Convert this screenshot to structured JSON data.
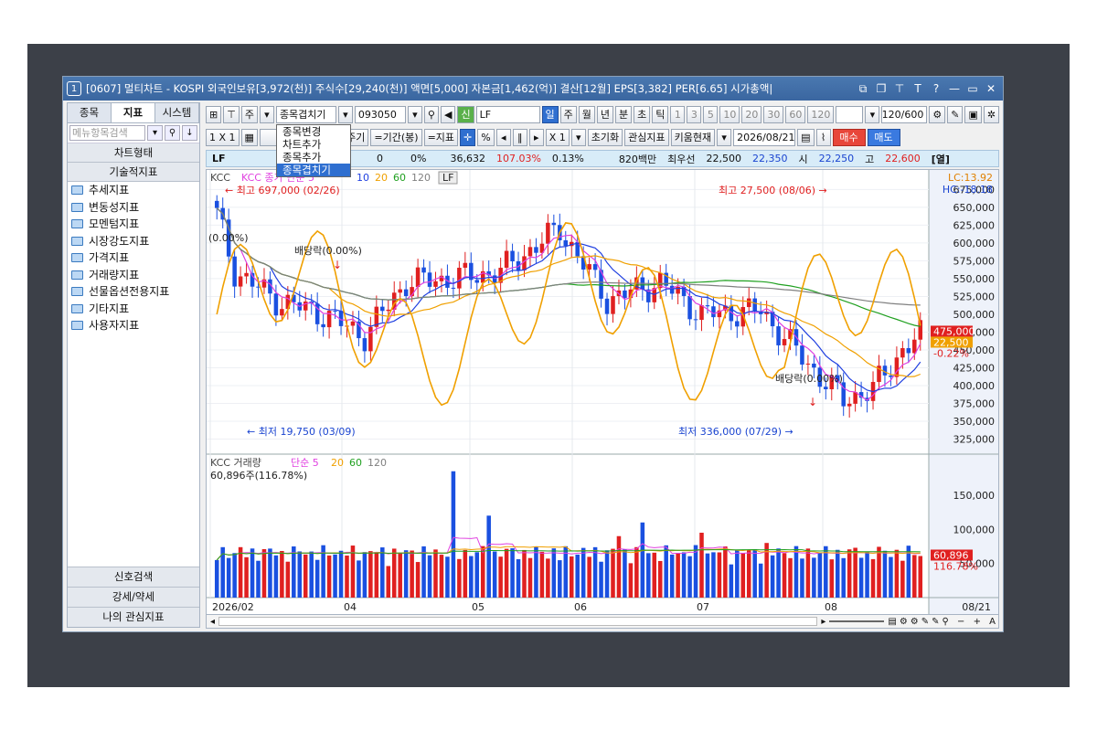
{
  "window": {
    "title_num": "1",
    "title": "[0607] 멀티차트 - KOSPI 외국인보유[3,972(천)] 주식수[29,240(천)] 액면[5,000] 자본금[1,462(억)] 결산[12월] EPS[3,382] PER[6.65] 시가총액|",
    "icons": [
      "⧉",
      "❐",
      "⊤",
      "T",
      "?",
      "—",
      "▭",
      "✕"
    ]
  },
  "left_panel": {
    "tabs": [
      "종목",
      "지표",
      "시스템"
    ],
    "active_tab": "지표",
    "search_placeholder": "메뉴항목검색",
    "section1": "차트형태",
    "section2": "기술적지표",
    "items": [
      "추세지표",
      "변동성지표",
      "모멘텀지표",
      "시장강도지표",
      "가격지표",
      "거래량지표",
      "선물옵션전용지표",
      "기타지표",
      "사용자지표"
    ],
    "bottom": [
      "신호검색",
      "강세/약세",
      "나의 관심지표"
    ]
  },
  "toolbar1": {
    "mode_label": "주",
    "combo_label": "종목겹치기",
    "code": "093050",
    "name": "LF",
    "new_badge": "신",
    "periods": [
      "일",
      "주",
      "월",
      "년",
      "분",
      "초",
      "틱"
    ],
    "active_period": "일",
    "intervals": [
      "1",
      "3",
      "5",
      "10",
      "20",
      "30",
      "60",
      "120"
    ],
    "count": "120/600"
  },
  "toolbar2": {
    "layout": "1 X 1",
    "cycle": "=주기",
    "range": "=기간(봉)",
    "indicator": "=지표",
    "zoom": "X 1",
    "reset": "초기화",
    "watch": "관심지표",
    "kiwoom": "키움현재",
    "date": "2026/08/21",
    "buy": "매수",
    "sell": "매도"
  },
  "dropdown": {
    "items": [
      "종목변경",
      "차트추가",
      "종목추가",
      "종목겹치기"
    ],
    "highlight": "종목겹치기"
  },
  "infobar": {
    "name": "LF",
    "v1": "0",
    "v2": "0%",
    "v3": "36,632",
    "v4": "107.03%",
    "v5": "0.13%",
    "v6": "820백만",
    "v7": "최우선",
    "v8": "22,500",
    "v9": "22,350",
    "v10": "시",
    "v11": "22,250",
    "v12": "고",
    "v13": "22,600",
    "v14": "[열]"
  },
  "price_panel": {
    "legend_prefix": "KCC",
    "legend_overlay": "KCC 종가 단순",
    "ma": [
      "5",
      "10",
      "20",
      "60",
      "120"
    ],
    "ma_colors": [
      "#e040e0",
      "#2040e0",
      "#f0a000",
      "#20a020",
      "#808080"
    ],
    "overlay_tag": "LF",
    "lc": "LC:13.92",
    "hc": "HC:-18.18",
    "high_label": "최고 697,000 (02/26)",
    "high2_label": "최고 27,500 (08/06)",
    "low_label": "최저 19,750 (03/09)",
    "low2_label": "최저 336,000 (07/29)",
    "div1": "배당락(0.00%)",
    "div2": "(0.00%)",
    "div3": "배당락(0.00%)",
    "yticks": [
      "675,000",
      "650,000",
      "625,000",
      "600,000",
      "575,000",
      "550,000",
      "525,000",
      "500,000",
      "475,000",
      "450,000",
      "425,000",
      "400,000",
      "375,000",
      "350,000",
      "325,000"
    ],
    "price_tag": "475,000",
    "overlay_tag_price": "22,500",
    "overlay_pct": "-0.22%"
  },
  "volume_panel": {
    "legend": "KCC 거래량",
    "ma_label": "단순",
    "ma": [
      "5",
      "20",
      "60",
      "120"
    ],
    "value_line": "60,896주(116.78%)",
    "yticks": [
      "150,000",
      "100,000",
      "50,000"
    ],
    "tag": "60,896",
    "tag_pct": "116.78%"
  },
  "x_axis": {
    "labels": [
      "2026/02",
      "04",
      "05",
      "06",
      "07",
      "08"
    ],
    "date_tag": "08/21"
  },
  "colors": {
    "up": "#e02020",
    "down": "#1a50e0",
    "overlay": "#f0a000"
  }
}
